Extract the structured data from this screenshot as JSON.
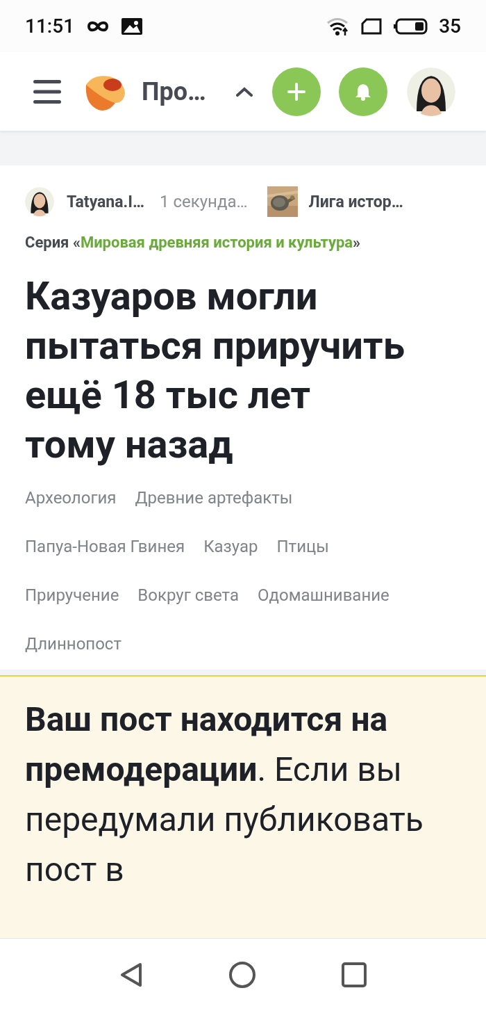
{
  "status_bar": {
    "time": "11:51",
    "battery": "35"
  },
  "header": {
    "title": "Про…"
  },
  "post": {
    "author": "Tatyana.I…",
    "time": "1 секунда…",
    "community": "Лига истор…",
    "series": {
      "prefix": "Серия «",
      "name": "Мировая древняя история и культура",
      "suffix": "»"
    },
    "title": "Казуаров могли пытаться приручить ещё 18 тыс лет тому назад",
    "tags": [
      "Археология",
      "Древние артефакты",
      "Папуа-Новая Гвинея",
      "Казуар",
      "Птицы",
      "Приручение",
      "Вокруг света",
      "Одомашнивание",
      "Длиннопост"
    ]
  },
  "notice": {
    "text": "**Ваш пост находится на премодерации**. Если вы передумали публиковать пост в"
  }
}
